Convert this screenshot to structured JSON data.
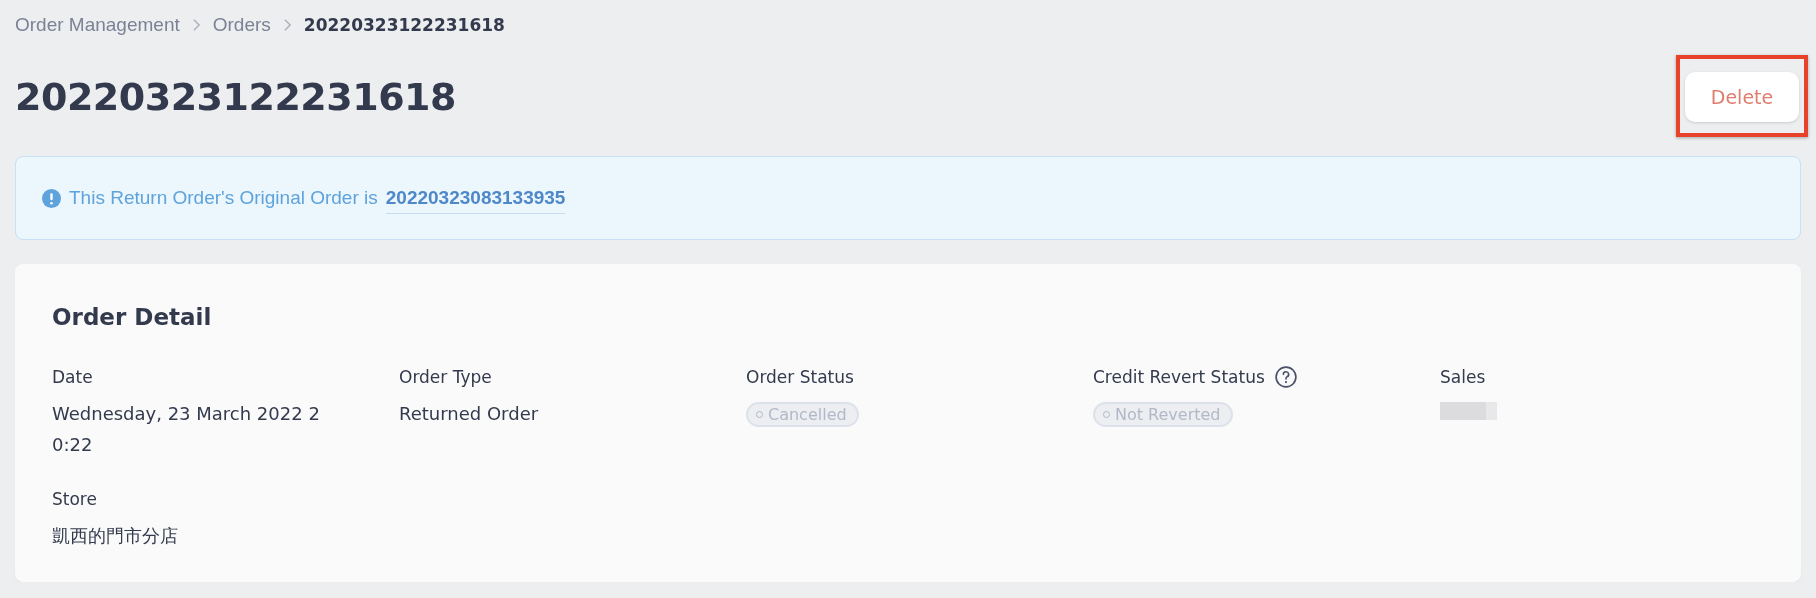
{
  "breadcrumb": [
    {
      "label": "Order Management",
      "current": false
    },
    {
      "label": "Orders",
      "current": false
    },
    {
      "label": "20220323122231618",
      "current": true
    }
  ],
  "title": "20220323122231618",
  "delete_button": {
    "label": "Delete",
    "highlighted": true
  },
  "notice": {
    "text": "This Return Order's Original Order is",
    "link": "20220323083133935"
  },
  "order_detail": {
    "title": "Order Detail",
    "fields": [
      {
        "label": "Date",
        "kind": "text",
        "value": "Wednesday, 23 March 2022 20:22"
      },
      {
        "label": "Order Type",
        "kind": "text",
        "value": "Returned Order"
      },
      {
        "label": "Order Status",
        "kind": "badge",
        "value": "Cancelled"
      },
      {
        "label": "Credit Revert Status",
        "kind": "badge",
        "value": "Not Reverted",
        "help": true
      },
      {
        "label": "Sales",
        "kind": "redacted"
      },
      {
        "label": "Store",
        "kind": "text",
        "value": "凱西的門市分店"
      }
    ]
  }
}
